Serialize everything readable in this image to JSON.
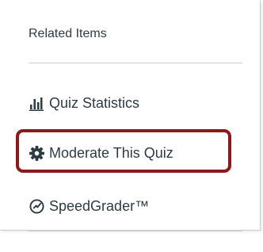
{
  "panel": {
    "heading": "Related Items",
    "items": [
      {
        "label": "Quiz Statistics",
        "icon": "bar-chart-icon"
      },
      {
        "label": "Moderate This Quiz",
        "icon": "gear-icon",
        "highlighted": true
      },
      {
        "label": "SpeedGrader™",
        "icon": "speedometer-icon"
      }
    ]
  },
  "colors": {
    "text": "#2d3b45",
    "divider": "#c7cdd1",
    "highlight_border": "#8b1a1f"
  }
}
